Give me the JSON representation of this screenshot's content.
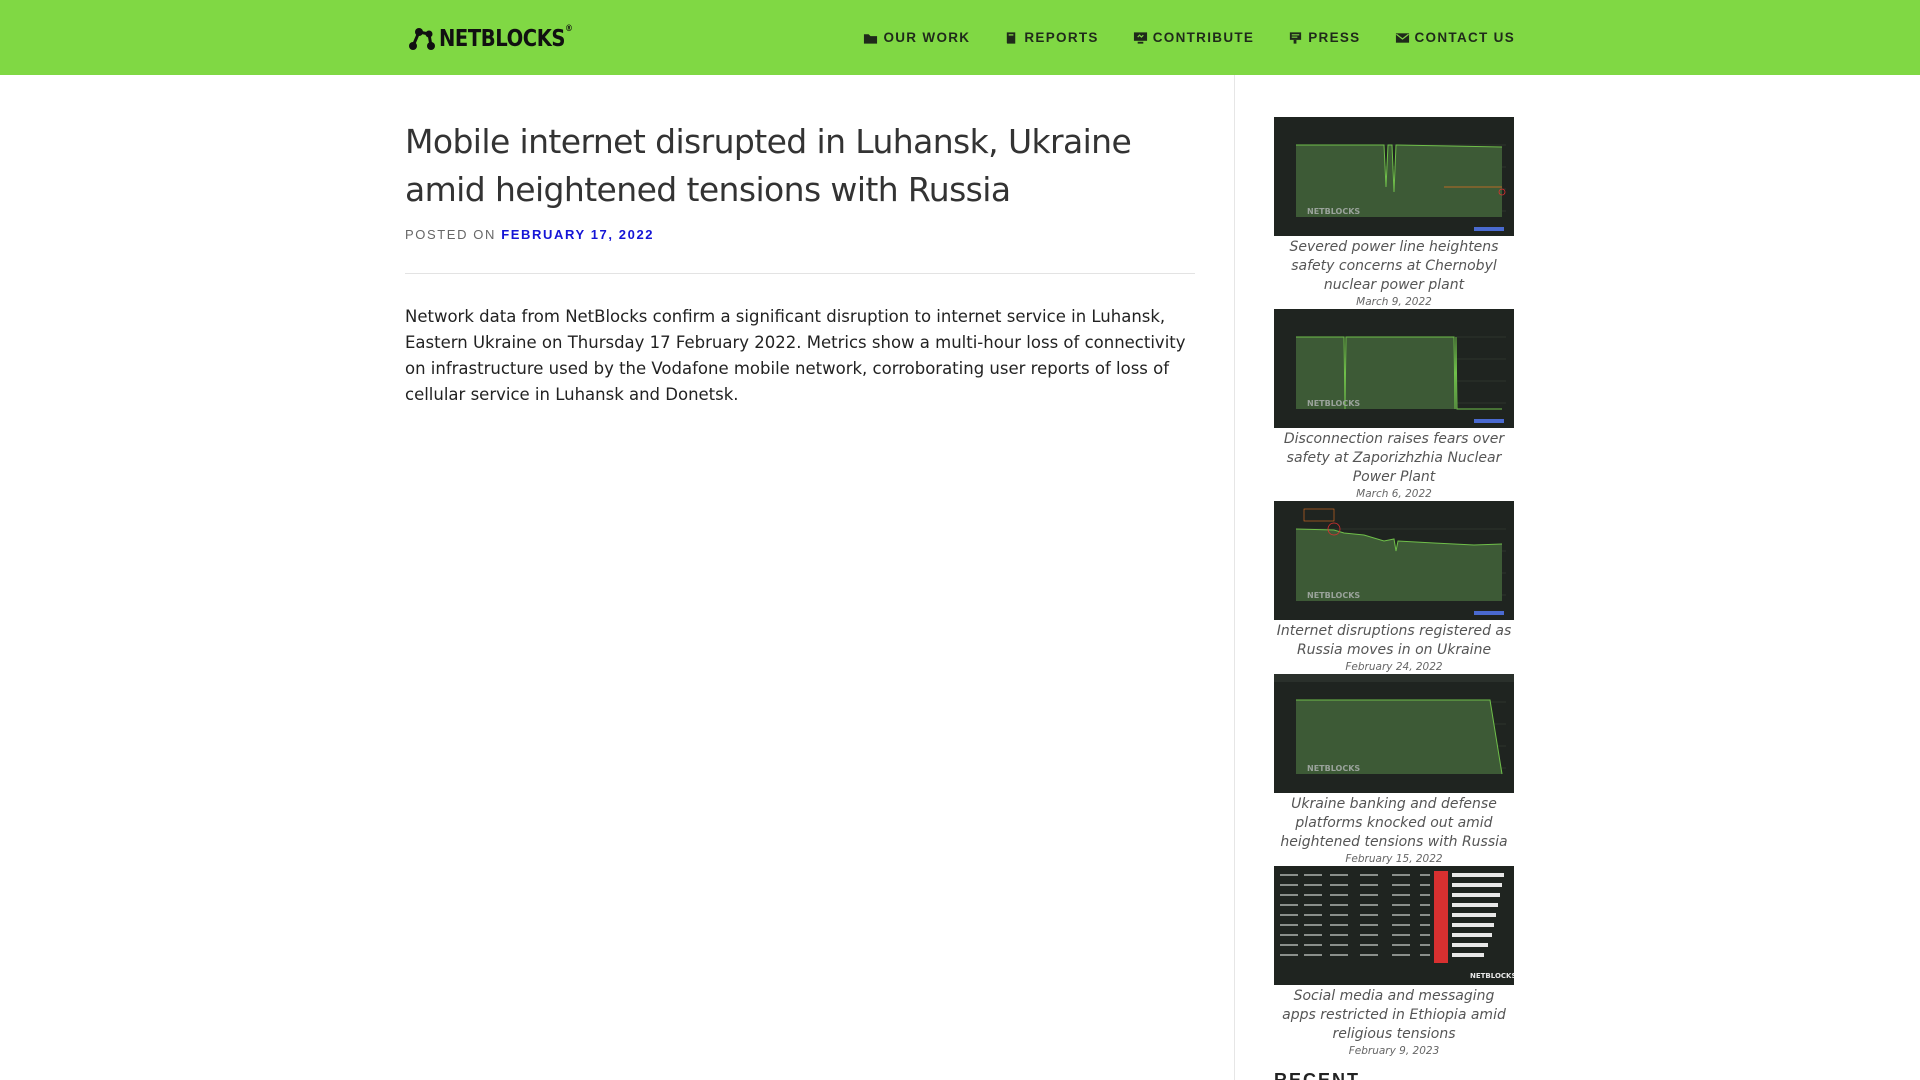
{
  "header": {
    "logo_text": "NETBLOCKS",
    "nav": [
      {
        "label": "OUR WORK",
        "icon": "folder-icon"
      },
      {
        "label": "REPORTS",
        "icon": "book-icon"
      },
      {
        "label": "CONTRIBUTE",
        "icon": "monitor-icon"
      },
      {
        "label": "PRESS",
        "icon": "megaphone-icon"
      },
      {
        "label": "CONTACT US",
        "icon": "mail-icon"
      }
    ]
  },
  "article": {
    "title": "Mobile internet disrupted in Luhansk, Ukraine amid heightened tensions with Russia",
    "posted_on": "POSTED ON",
    "date": "FEBRUARY 17, 2022",
    "body": "Network data from NetBlocks confirm a significant disruption to internet service in Luhansk, Eastern Ukraine on Thursday 17 February 2022. Metrics show a multi-hour loss of connectivity on infrastructure used by the Vodafone mobile network, corroborating user reports of loss of cellular service in Luhansk and Donetsk."
  },
  "sidebar": {
    "posts": [
      {
        "title": "Severed power line heightens safety concerns at Chernobyl nuclear power plant",
        "date": "March 9, 2022"
      },
      {
        "title": "Disconnection raises fears over safety at Zaporizhzhia Nuclear Power Plant",
        "date": "March 6, 2022"
      },
      {
        "title": "Internet disruptions registered as Russia moves in on Ukraine",
        "date": "February 24, 2022"
      },
      {
        "title": "Ukraine banking and defense platforms knocked out amid heightened tensions with Russia",
        "date": "February 15, 2022"
      },
      {
        "title": "Social media and messaging apps restricted in Ethiopia amid religious tensions",
        "date": "February 9, 2023"
      }
    ],
    "recent_heading": "RECENT"
  },
  "colors": {
    "header_bg": "#80d844",
    "link": "#1515d6",
    "thumb_bg": "#1f2420",
    "chart_fill": "#3d5a36",
    "chart_line": "#6fbf4a"
  }
}
